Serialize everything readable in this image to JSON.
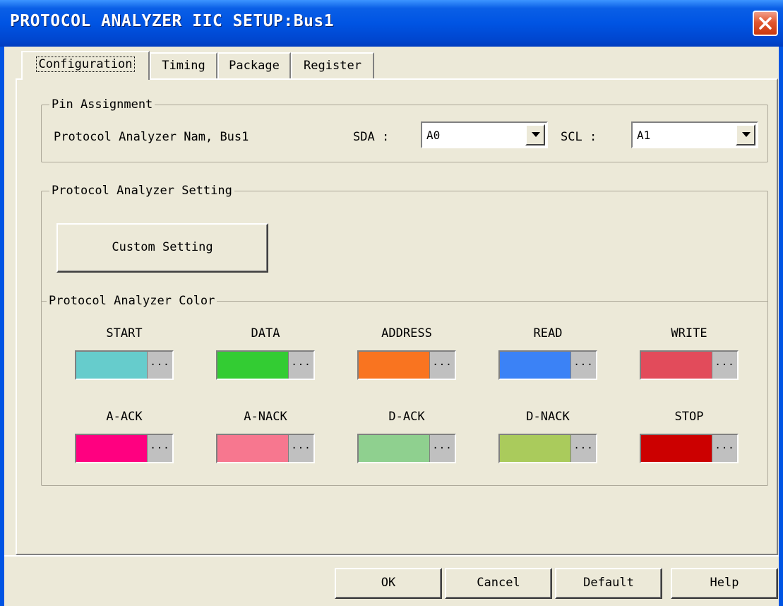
{
  "window": {
    "title": "PROTOCOL ANALYZER IIC SETUP:Bus1",
    "close_label": "close"
  },
  "tabs": [
    {
      "label": "Configuration",
      "active": true
    },
    {
      "label": "Timing",
      "active": false
    },
    {
      "label": "Package",
      "active": false
    },
    {
      "label": "Register",
      "active": false
    }
  ],
  "pin_assignment": {
    "group_label": "Pin Assignment",
    "name_label": "Protocol Analyzer Nam",
    "name_value": "Bus1",
    "sda_label": "SDA :",
    "sda_value": "A0",
    "scl_label": "SCL :",
    "scl_value": "A1"
  },
  "setting": {
    "group_label": "Protocol Analyzer Setting",
    "custom_button": "Custom Setting"
  },
  "color": {
    "group_label": "Protocol Analyzer Color",
    "more_label": "...",
    "items": [
      {
        "label": "START",
        "color": "#66cccc"
      },
      {
        "label": "DATA",
        "color": "#33cc33"
      },
      {
        "label": "ADDRESS",
        "color": "#f97420"
      },
      {
        "label": "READ",
        "color": "#3b82f6"
      },
      {
        "label": "WRITE",
        "color": "#e24b5b"
      },
      {
        "label": "A-ACK",
        "color": "#ff0080"
      },
      {
        "label": "A-NACK",
        "color": "#f7778f"
      },
      {
        "label": "D-ACK",
        "color": "#8fd08f"
      },
      {
        "label": "D-NACK",
        "color": "#aacb5c"
      },
      {
        "label": "STOP",
        "color": "#cc0000"
      }
    ]
  },
  "footer": {
    "ok": "OK",
    "cancel": "Cancel",
    "default": "Default",
    "help": "Help"
  }
}
